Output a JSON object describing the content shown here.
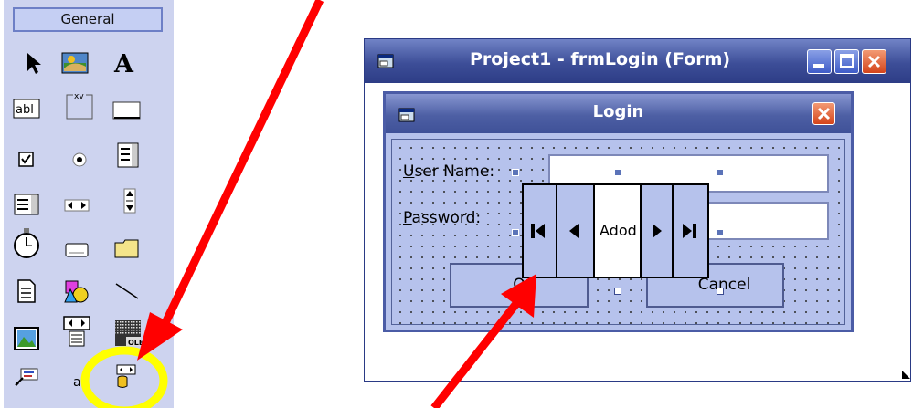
{
  "toolbox": {
    "header": "General",
    "tools": [
      {
        "name": "pointer-icon"
      },
      {
        "name": "picturebox-icon"
      },
      {
        "name": "label-icon"
      },
      {
        "name": "textbox-icon",
        "text": "abl"
      },
      {
        "name": "frame-icon",
        "text": "xv"
      },
      {
        "name": "commandbutton-icon"
      },
      {
        "name": "checkbox-icon"
      },
      {
        "name": "optionbutton-icon"
      },
      {
        "name": "combobox-icon"
      },
      {
        "name": "listbox-icon"
      },
      {
        "name": "hscrollbar-icon"
      },
      {
        "name": "vscrollbar-icon"
      },
      {
        "name": "timer-icon"
      },
      {
        "name": "drivelistbox-icon"
      },
      {
        "name": "dirlistbox-icon"
      },
      {
        "name": "filelistbox-icon"
      },
      {
        "name": "shape-icon"
      },
      {
        "name": "line-icon"
      },
      {
        "name": "image-icon"
      },
      {
        "name": "data-icon"
      },
      {
        "name": "ole-icon"
      },
      {
        "name": "custom-control-icon"
      },
      {
        "name": "custom-control-2-icon"
      },
      {
        "name": "adodc-icon"
      }
    ]
  },
  "window": {
    "title": "Project1 - frmLogin (Form)"
  },
  "login_form": {
    "title": "Login",
    "user_label": "User Name:",
    "password_label": "Password:",
    "ok_button": "O",
    "cancel_button": "Cancel"
  },
  "ado_control": {
    "caption": "Adod"
  },
  "colors": {
    "annotation_arrow": "#ff0000",
    "highlight_circle": "#ffff00"
  }
}
